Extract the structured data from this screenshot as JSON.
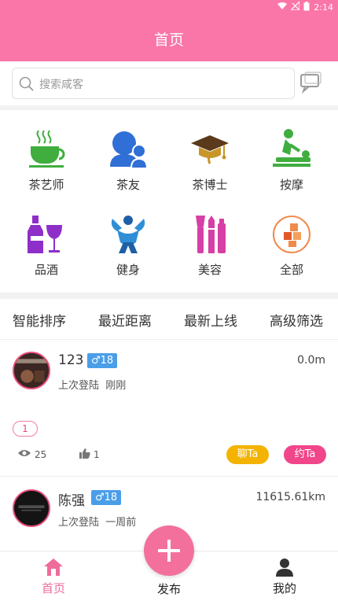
{
  "status_bar": {
    "time": "2:14"
  },
  "header": {
    "title": "首页"
  },
  "search": {
    "placeholder": "搜索咸客"
  },
  "categories": [
    {
      "label": "茶艺师",
      "icon": "tea-cup-icon",
      "color": "#3fae3f"
    },
    {
      "label": "茶友",
      "icon": "users-icon",
      "color": "#2f6fd6"
    },
    {
      "label": "茶博士",
      "icon": "graduation-cap-icon",
      "color": "#b8860b"
    },
    {
      "label": "按摩",
      "icon": "massage-icon",
      "color": "#3fae3f"
    },
    {
      "label": "品酒",
      "icon": "wine-icon",
      "color": "#8e2fc9"
    },
    {
      "label": "健身",
      "icon": "fitness-icon",
      "color": "#2f8fd6"
    },
    {
      "label": "美容",
      "icon": "cosmetics-icon",
      "color": "#d63fa5"
    },
    {
      "label": "全部",
      "icon": "all-categories-icon",
      "color": "#f08a4b"
    }
  ],
  "sort_options": [
    "智能排序",
    "最近距离",
    "最新上线",
    "高级筛选"
  ],
  "users": [
    {
      "name": "123",
      "gender_symbol": "♂",
      "age": "18",
      "distance": "0.0m",
      "last_login_label": "上次登陆",
      "last_login": "刚刚",
      "tag": "1",
      "views": "25",
      "likes": "1",
      "chat_label": "聊Ta",
      "date_label": "约Ta"
    },
    {
      "name": "陈强",
      "gender_symbol": "♂",
      "age": "18",
      "distance": "11615.61km",
      "last_login_label": "上次登陆",
      "last_login": "一周前"
    }
  ],
  "tabbar": {
    "home": "首页",
    "publish": "发布",
    "mine": "我的"
  },
  "colors": {
    "brand": "#fb76a8",
    "gender_badge": "#4a9ee8",
    "chat": "#f3b300",
    "date": "#f1468a"
  }
}
